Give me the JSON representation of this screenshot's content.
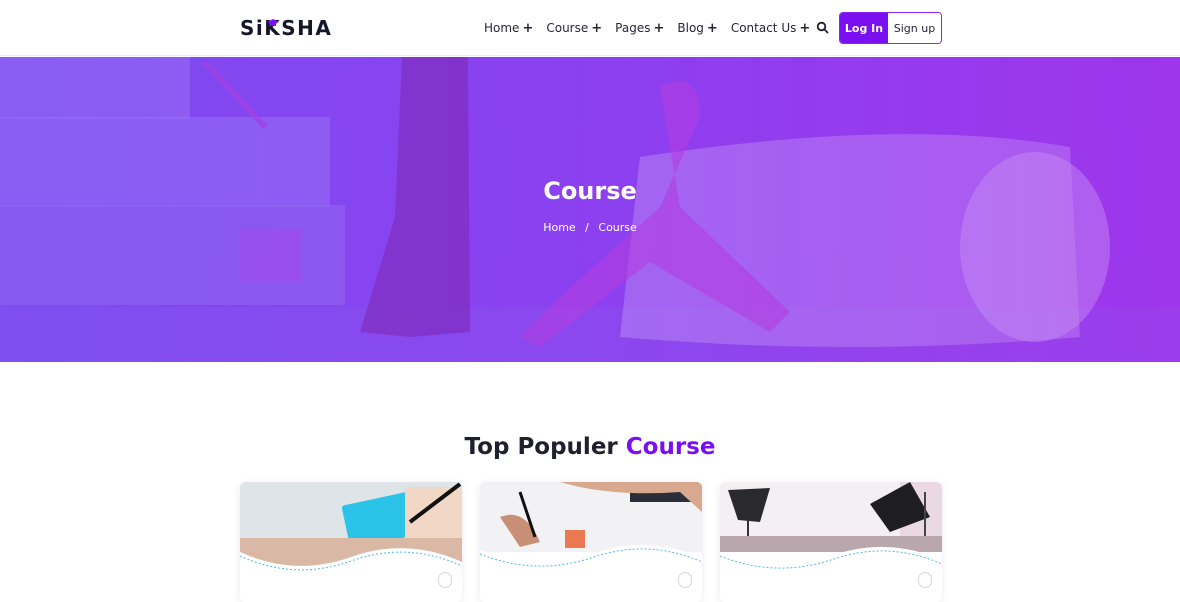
{
  "brand": {
    "name_prefix": "S",
    "name_i": "i",
    "name_suffix": "KSHA",
    "icon": "graduation-cap-icon"
  },
  "nav": {
    "items": [
      {
        "label": "Home",
        "suffix": "+"
      },
      {
        "label": "Course",
        "suffix": "+"
      },
      {
        "label": "Pages",
        "suffix": "+"
      },
      {
        "label": "Blog",
        "suffix": "+"
      },
      {
        "label": "Contact Us",
        "suffix": "+"
      }
    ],
    "search_icon": "search-icon",
    "login_label": "Log In",
    "signup_label": "Sign up"
  },
  "hero": {
    "title": "Course",
    "breadcrumb": {
      "home": "Home",
      "separator": "/",
      "current": "Course"
    }
  },
  "section": {
    "title_main": "Top Populer ",
    "title_accent": "Course"
  },
  "colors": {
    "accent": "#7a10ef",
    "hero_left": "#7f52f2",
    "hero_right": "#9b3aeb",
    "text": "#1f1f2e"
  }
}
